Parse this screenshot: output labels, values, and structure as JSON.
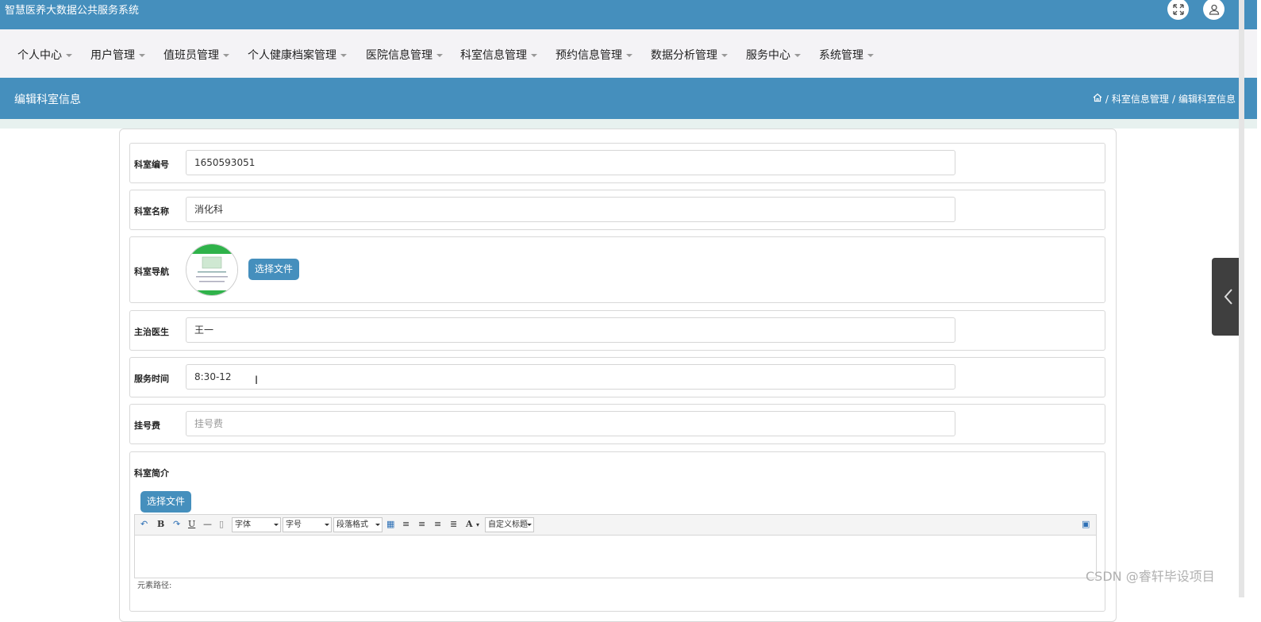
{
  "app": {
    "title": "智慧医养大数据公共服务系统"
  },
  "nav": {
    "items": [
      "个人中心",
      "用户管理",
      "值班员管理",
      "个人健康档案管理",
      "医院信息管理",
      "科室信息管理",
      "预约信息管理",
      "数据分析管理",
      "服务中心",
      "系统管理"
    ]
  },
  "page": {
    "title": "编辑科室信息",
    "breadcrumb": {
      "section": "科室信息管理",
      "separator": "/",
      "current": "编辑科室信息"
    }
  },
  "form": {
    "dept_id": {
      "label": "科室编号",
      "value": "1650593051"
    },
    "dept_name": {
      "label": "科室名称",
      "value": "消化科"
    },
    "dept_nav": {
      "label": "科室导航",
      "button": "选择文件"
    },
    "doctor": {
      "label": "主治医生",
      "value": "王一"
    },
    "service_time": {
      "label": "服务时间",
      "value": "8:30-12"
    },
    "fee": {
      "label": "挂号费",
      "placeholder": "挂号费"
    },
    "intro": {
      "label": "科室简介",
      "button": "选择文件",
      "toolbar": {
        "font": "字体",
        "size": "字号",
        "paragraph": "段落格式",
        "custom_title": "自定义标题"
      },
      "status_label": "元素路径:"
    }
  },
  "watermark": "CSDN @睿轩毕设项目",
  "colors": {
    "primary": "#458fbd",
    "nav_bg": "#f4f3f6",
    "strip": "#e7f1ef"
  }
}
